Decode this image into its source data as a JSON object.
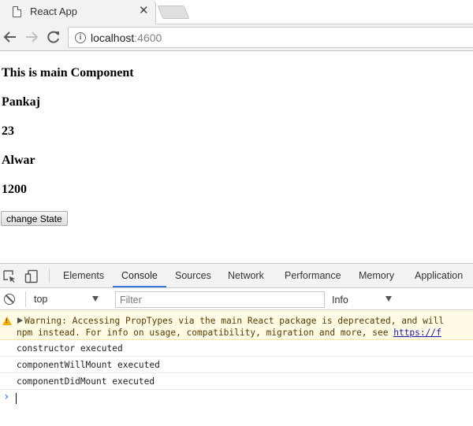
{
  "browser": {
    "tab_title": "React App",
    "tab_close": "✕",
    "url_host": "localhost",
    "url_port": ":4600"
  },
  "page": {
    "heading": "This is main Component",
    "name": "Pankaj",
    "age": "23",
    "city": "Alwar",
    "salary": "1200",
    "button_label": "change State"
  },
  "devtools": {
    "tabs": [
      "Elements",
      "Console",
      "Sources",
      "Network",
      "Performance",
      "Memory",
      "Application"
    ],
    "active_tab": "Console",
    "context": "top",
    "filter_placeholder": "Filter",
    "level": "Info",
    "warning": {
      "line1": "Warning: Accessing PropTypes via the main React package is deprecated, and will",
      "line2_prefix": "npm instead. For info on usage, compatibility, migration and more, see ",
      "line2_link": "https://f"
    },
    "logs": [
      "constructor executed",
      "componentWillMount executed",
      "componentDidMount executed"
    ],
    "accent": "#3879d9"
  }
}
